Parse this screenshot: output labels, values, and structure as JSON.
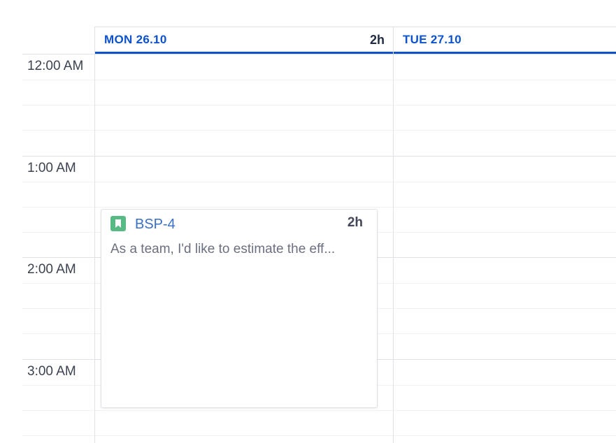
{
  "days": [
    {
      "label": "MON  26.10",
      "total": "2h"
    },
    {
      "label": "TUE  27.10",
      "total": ""
    }
  ],
  "time_labels": [
    "12:00 AM",
    "1:00 AM",
    "2:00 AM",
    "3:00 AM"
  ],
  "worklog": {
    "issue_key": "BSP-4",
    "issue_type_icon": "story-bookmark-icon",
    "duration": "2h",
    "summary": "As a team, I'd like to estimate the eff..."
  },
  "colors": {
    "accent": "#0b52cc",
    "story_icon": "#57b984",
    "issue_link": "#3a6fc4"
  }
}
